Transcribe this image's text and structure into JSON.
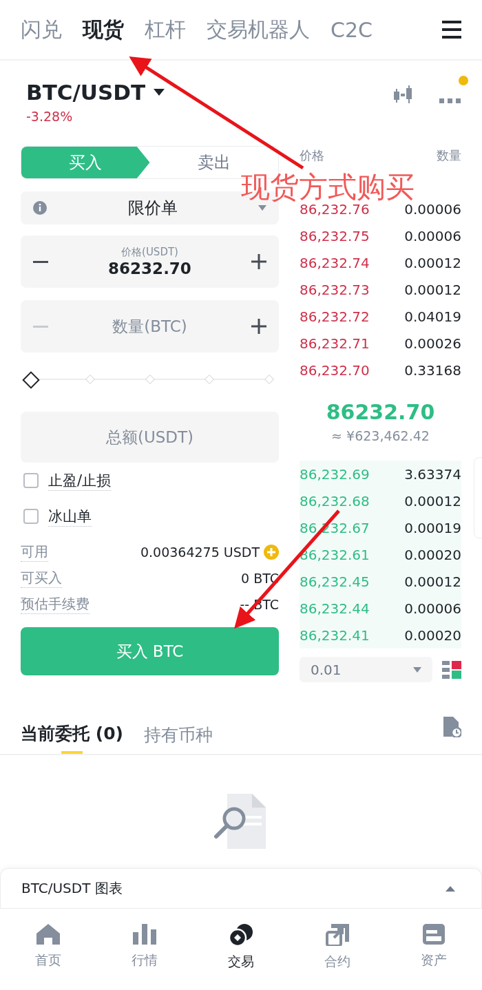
{
  "top_tabs": [
    {
      "label": "闪兑",
      "selected": false
    },
    {
      "label": "现货",
      "selected": true
    },
    {
      "label": "杠杆",
      "selected": false
    },
    {
      "label": "交易机器人",
      "selected": false
    },
    {
      "label": "C2C",
      "selected": false
    }
  ],
  "pair": {
    "symbol": "BTC/USDT",
    "change": "-3.28%",
    "notification": true
  },
  "side_toggle": [
    {
      "label": "买入",
      "selected": true
    },
    {
      "label": "卖出",
      "selected": false
    }
  ],
  "order_type": {
    "value": "限价单"
  },
  "price_field": {
    "label": "价格(USDT)",
    "value": "86232.70",
    "decrement_disabled": false
  },
  "quantity_field": {
    "placeholder": "数量(BTC)",
    "decrement_disabled": true
  },
  "slider": {
    "level": 0
  },
  "total_field": {
    "placeholder": "总额(USDT)"
  },
  "options": [
    {
      "label": "止盈/止损",
      "checked": false
    },
    {
      "label": "冰山单",
      "checked": false
    }
  ],
  "balances": [
    {
      "label": "可用",
      "value": "0.00364275 USDT",
      "add": true
    },
    {
      "label": "可买入",
      "value": "0 BTC",
      "add": false
    },
    {
      "label": "预估手续费",
      "value": "-- BTC",
      "add": false
    }
  ],
  "submit_button": "买入 BTC",
  "order_book": {
    "price_header": [
      "价格"
    ],
    "amount_header": [
      "数量"
    ],
    "asks": [
      {
        "price": "86,232.76",
        "amount": "0.00006"
      },
      {
        "price": "86,232.75",
        "amount": "0.00006"
      },
      {
        "price": "86,232.74",
        "amount": "0.00012"
      },
      {
        "price": "86,232.73",
        "amount": "0.00012"
      },
      {
        "price": "86,232.72",
        "amount": "0.04019"
      },
      {
        "price": "86,232.71",
        "amount": "0.00026"
      },
      {
        "price": "86,232.70",
        "amount": "0.33168"
      }
    ],
    "last_price": "86232.70",
    "last_price_cny": "≈ ¥623,462.42",
    "bids": [
      {
        "price": "86,232.69",
        "amount": "3.63374"
      },
      {
        "price": "86,232.68",
        "amount": "0.00012"
      },
      {
        "price": "86,232.67",
        "amount": "0.00019"
      },
      {
        "price": "86,232.61",
        "amount": "0.00020"
      },
      {
        "price": "86,232.45",
        "amount": "0.00012"
      },
      {
        "price": "86,232.44",
        "amount": "0.00006"
      },
      {
        "price": "86,232.41",
        "amount": "0.00020"
      }
    ],
    "precision": "0.01"
  },
  "order_tabs": [
    {
      "label": "当前委托 (0)",
      "selected": true
    },
    {
      "label": "持有币种",
      "selected": false
    }
  ],
  "chart_bar": {
    "label": "BTC/USDT 图表"
  },
  "bottom_nav": [
    {
      "label": "首页",
      "kind": "home",
      "selected": false
    },
    {
      "label": "行情",
      "kind": "markets",
      "selected": false
    },
    {
      "label": "交易",
      "kind": "trade",
      "selected": true
    },
    {
      "label": "合约",
      "kind": "futures",
      "selected": false
    },
    {
      "label": "资产",
      "kind": "wallet",
      "selected": false
    }
  ],
  "annotation": {
    "caption": "现货方式购买"
  }
}
